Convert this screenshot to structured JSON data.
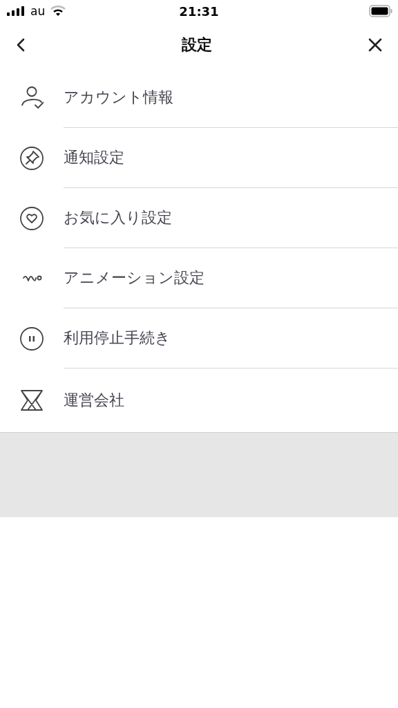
{
  "status_bar": {
    "carrier": "au",
    "time": "21:31"
  },
  "nav": {
    "title": "設定"
  },
  "items": [
    {
      "kind": "account",
      "label": "アカウント情報"
    },
    {
      "kind": "pin",
      "label": "通知設定"
    },
    {
      "kind": "heart",
      "label": "お気に入り設定"
    },
    {
      "kind": "animation",
      "label": "アニメーション設定"
    },
    {
      "kind": "pause",
      "label": "利用停止手続き"
    },
    {
      "kind": "company",
      "label": "運営会社"
    }
  ]
}
